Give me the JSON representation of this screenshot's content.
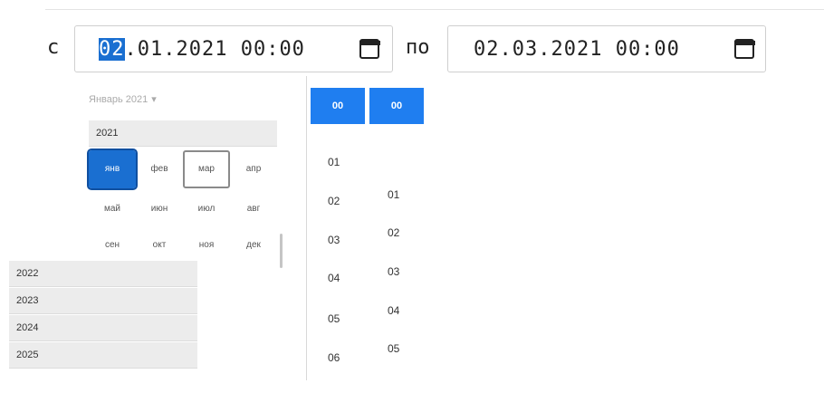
{
  "range": {
    "from_label": "с",
    "to_label": "по",
    "from": {
      "selected_segment": "02",
      "rest": ".01.2021 00:00"
    },
    "to": {
      "value": "02.03.2021 00:00"
    }
  },
  "picker": {
    "month_header": "Январь 2021",
    "header_caret": "▾",
    "current_year": "2021",
    "months": [
      "янв",
      "фев",
      "мар",
      "апр",
      "май",
      "июн",
      "июл",
      "авг",
      "сен",
      "окт",
      "ноя",
      "дек"
    ],
    "selected_month": "янв",
    "hovered_month": "мар",
    "other_years": [
      "2022",
      "2023",
      "2024",
      "2025"
    ]
  },
  "time": {
    "hour_selected": "00",
    "minute_selected": "00",
    "hours": [
      "01",
      "02",
      "03",
      "04",
      "05",
      "06"
    ],
    "minutes": [
      "01",
      "02",
      "03",
      "04",
      "05"
    ]
  }
}
